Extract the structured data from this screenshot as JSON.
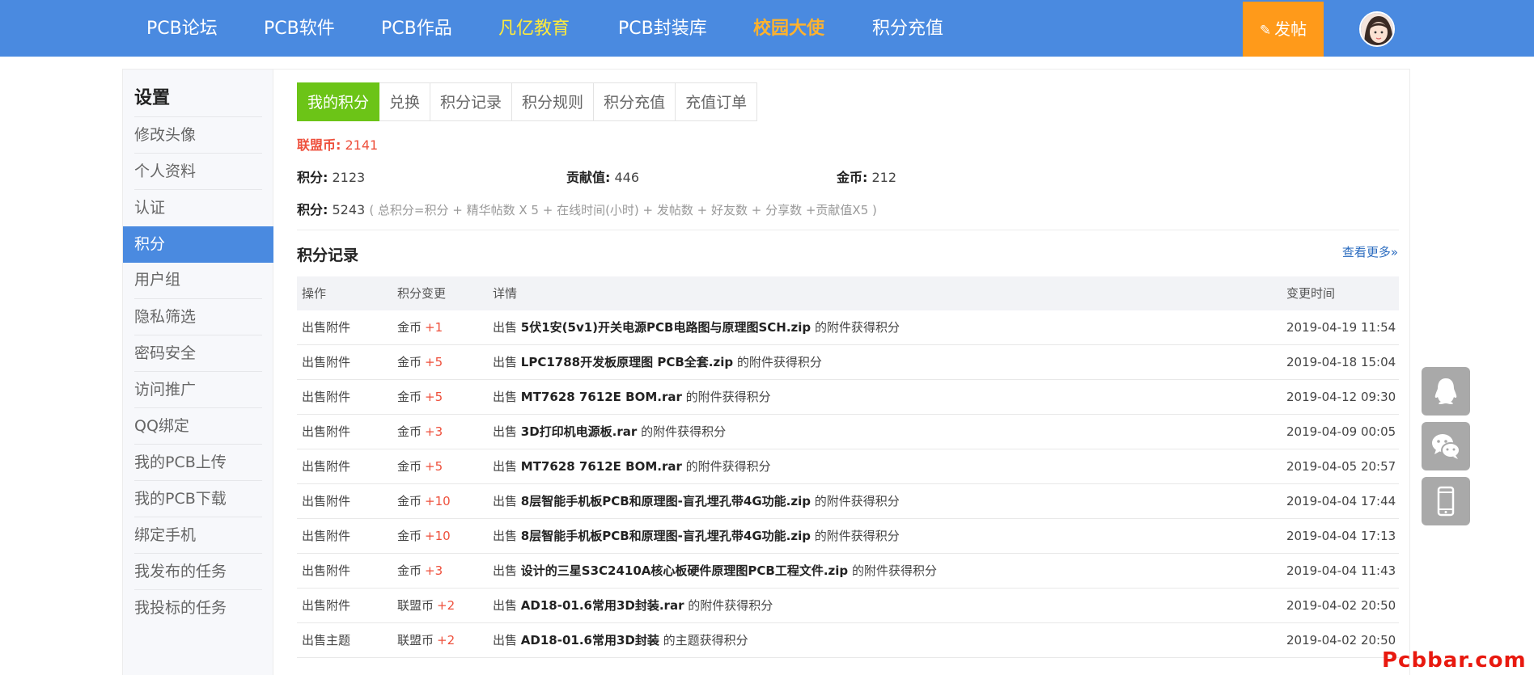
{
  "nav": {
    "items": [
      {
        "label": "PCB论坛"
      },
      {
        "label": "PCB软件"
      },
      {
        "label": "PCB作品"
      },
      {
        "label": "凡亿教育"
      },
      {
        "label": "PCB封装库"
      },
      {
        "label": "校园大使"
      },
      {
        "label": "积分充值"
      }
    ],
    "post_label": "发帖"
  },
  "sidebar": {
    "title": "设置",
    "items": [
      {
        "label": "修改头像"
      },
      {
        "label": "个人资料"
      },
      {
        "label": "认证"
      },
      {
        "label": "积分"
      },
      {
        "label": "用户组"
      },
      {
        "label": "隐私筛选"
      },
      {
        "label": "密码安全"
      },
      {
        "label": "访问推广"
      },
      {
        "label": "QQ绑定"
      },
      {
        "label": "我的PCB上传"
      },
      {
        "label": "我的PCB下载"
      },
      {
        "label": "绑定手机"
      },
      {
        "label": "我发布的任务"
      },
      {
        "label": "我投标的任务"
      }
    ]
  },
  "tabs": [
    {
      "label": "我的积分"
    },
    {
      "label": "兑换"
    },
    {
      "label": "积分记录"
    },
    {
      "label": "积分规则"
    },
    {
      "label": "积分充值"
    },
    {
      "label": "充值订单"
    }
  ],
  "summary": {
    "union_label": "联盟币:",
    "union_value": "2141",
    "points_label": "积分:",
    "points_value": "2123",
    "contrib_label": "贡献值:",
    "contrib_value": "446",
    "gold_label": "金币:",
    "gold_value": "212",
    "total_label": "积分:",
    "total_value": "5243",
    "formula_note": "( 总积分=积分 + 精华帖数 X 5 + 在线时间(小时) + 发帖数 + 好友数 + 分享数 +贡献值X5 )"
  },
  "records": {
    "title": "积分记录",
    "more": "查看更多»",
    "headers": [
      "操作",
      "积分变更",
      "详情",
      "变更时间"
    ],
    "rows": [
      {
        "op": "出售附件",
        "unit": "金币",
        "delta": "+1",
        "pre": "出售",
        "file": "5伏1安(5v1)开关电源PCB电路图与原理图SCH.zip",
        "post": "的附件获得积分",
        "time": "2019-04-19 11:54"
      },
      {
        "op": "出售附件",
        "unit": "金币",
        "delta": "+5",
        "pre": "出售",
        "file": "LPC1788开发板原理图 PCB全套.zip",
        "post": "的附件获得积分",
        "time": "2019-04-18 15:04"
      },
      {
        "op": "出售附件",
        "unit": "金币",
        "delta": "+5",
        "pre": "出售",
        "file": "MT7628 7612E BOM.rar",
        "post": "的附件获得积分",
        "time": "2019-04-12 09:30"
      },
      {
        "op": "出售附件",
        "unit": "金币",
        "delta": "+3",
        "pre": "出售",
        "file": "3D打印机电源板.rar",
        "post": "的附件获得积分",
        "time": "2019-04-09 00:05"
      },
      {
        "op": "出售附件",
        "unit": "金币",
        "delta": "+5",
        "pre": "出售",
        "file": "MT7628 7612E BOM.rar",
        "post": "的附件获得积分",
        "time": "2019-04-05 20:57"
      },
      {
        "op": "出售附件",
        "unit": "金币",
        "delta": "+10",
        "pre": "出售",
        "file": "8层智能手机板PCB和原理图-盲孔埋孔带4G功能.zip",
        "post": "的附件获得积分",
        "time": "2019-04-04 17:44"
      },
      {
        "op": "出售附件",
        "unit": "金币",
        "delta": "+10",
        "pre": "出售",
        "file": "8层智能手机板PCB和原理图-盲孔埋孔带4G功能.zip",
        "post": "的附件获得积分",
        "time": "2019-04-04 17:13"
      },
      {
        "op": "出售附件",
        "unit": "金币",
        "delta": "+3",
        "pre": "出售",
        "file": "设计的三星S3C2410A核心板硬件原理图PCB工程文件.zip",
        "post": "的附件获得积分",
        "time": "2019-04-04 11:43"
      },
      {
        "op": "出售附件",
        "unit": "联盟币",
        "delta": "+2",
        "pre": "出售",
        "file": "AD18-01.6常用3D封装.rar",
        "post": "的附件获得积分",
        "time": "2019-04-02 20:50"
      },
      {
        "op": "出售主题",
        "unit": "联盟币",
        "delta": "+2",
        "pre": "出售",
        "file": "AD18-01.6常用3D封装",
        "post": "的主题获得积分",
        "time": "2019-04-02 20:50"
      }
    ]
  },
  "floating": [
    {
      "icon": "qq-icon"
    },
    {
      "icon": "wechat-icon"
    },
    {
      "icon": "mobile-icon"
    }
  ],
  "watermark": "Pcbbar.com",
  "colors": {
    "nav_bg": "#4a8ae0",
    "tab_active": "#6cc417",
    "post_button": "#ff9a1a",
    "highlight_red": "#ee4f3b",
    "link_blue": "#2a6bbf"
  }
}
